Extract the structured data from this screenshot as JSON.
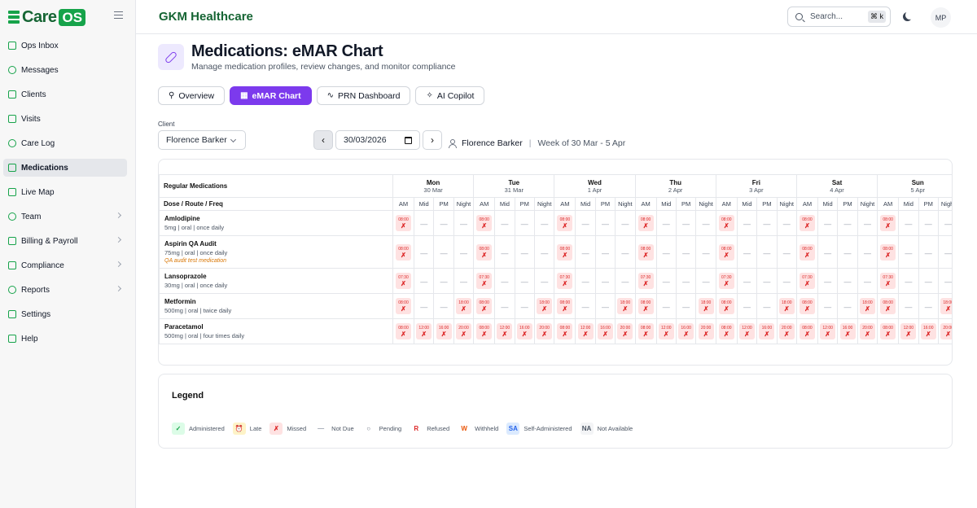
{
  "app": {
    "logo_word": "Care",
    "logo_badge": "OS",
    "org_name": "GKM Healthcare"
  },
  "sidebar": {
    "items": [
      {
        "label": "Ops Inbox",
        "icon": "inbox-icon"
      },
      {
        "label": "Messages",
        "icon": "message-icon"
      },
      {
        "label": "Clients",
        "icon": "users-icon"
      },
      {
        "label": "Visits",
        "icon": "calendar-icon"
      },
      {
        "label": "Care Log",
        "icon": "clipboard-icon"
      },
      {
        "label": "Medications",
        "icon": "pill-icon",
        "active": true
      },
      {
        "label": "Live Map",
        "icon": "radio-icon"
      },
      {
        "label": "Team",
        "icon": "team-icon",
        "chevron": true
      },
      {
        "label": "Billing & Payroll",
        "icon": "billing-icon",
        "chevron": true
      },
      {
        "label": "Compliance",
        "icon": "shield-icon",
        "chevron": true
      },
      {
        "label": "Reports",
        "icon": "bar-chart-icon",
        "chevron": true
      },
      {
        "label": "Settings",
        "icon": "gear-icon"
      },
      {
        "label": "Help",
        "icon": "help-icon"
      }
    ]
  },
  "topbar": {
    "search_placeholder": "Search...",
    "shortcut": "⌘ k",
    "avatar_initials": "MP"
  },
  "page": {
    "title": "Medications: eMAR Chart",
    "subtitle": "Manage medication profiles, review changes, and monitor compliance"
  },
  "tabs": [
    {
      "label": "Overview",
      "icon": "⚲",
      "active": false
    },
    {
      "label": "eMAR Chart",
      "icon": "▦",
      "active": true
    },
    {
      "label": "PRN Dashboard",
      "icon": "∿",
      "active": false
    },
    {
      "label": "AI Copilot",
      "icon": "✧",
      "active": false
    }
  ],
  "filters": {
    "client_label": "Client",
    "client_value": "Florence Barker",
    "date_value": "30/03/2026",
    "prev_label": "‹",
    "next_label": "›",
    "client_name": "Florence Barker",
    "divider": "|",
    "week_label": "Week of 30 Mar - 5 Apr"
  },
  "emar": {
    "header_medications": "Regular Medications",
    "header_dose": "Dose / Route / Freq",
    "days": [
      {
        "name": "Mon",
        "date": "30 Mar"
      },
      {
        "name": "Tue",
        "date": "31 Mar"
      },
      {
        "name": "Wed",
        "date": "1 Apr"
      },
      {
        "name": "Thu",
        "date": "2 Apr"
      },
      {
        "name": "Fri",
        "date": "3 Apr"
      },
      {
        "name": "Sat",
        "date": "4 Apr"
      },
      {
        "name": "Sun",
        "date": "5 Apr"
      }
    ],
    "slots": [
      "AM",
      "Mid",
      "PM",
      "Night"
    ],
    "dash": "—",
    "missed_mark": "✗",
    "medications": [
      {
        "name": "Amlodipine",
        "detail": "5mg | oral | once daily",
        "note": "",
        "slots": [
          "08:00",
          null,
          null,
          null
        ]
      },
      {
        "name": "Aspirin QA Audit",
        "detail": "75mg | oral | once daily",
        "note": "QA audit test medication",
        "slots": [
          "08:00",
          null,
          null,
          null
        ]
      },
      {
        "name": "Lansoprazole",
        "detail": "30mg | oral | once daily",
        "note": "",
        "slots": [
          "07:30",
          null,
          null,
          null
        ]
      },
      {
        "name": "Metformin",
        "detail": "500mg | oral | twice daily",
        "note": "",
        "slots": [
          "08:00",
          null,
          null,
          "18:00"
        ]
      },
      {
        "name": "Paracetamol",
        "detail": "500mg | oral | four times daily",
        "note": "",
        "slots": [
          "08:00",
          "12:00",
          "16:00",
          "20:00"
        ]
      }
    ]
  },
  "legend": {
    "title": "Legend",
    "items": [
      {
        "symbol": "✓",
        "label": "Administered",
        "bg": "#dcfce7",
        "fg": "#16a34a"
      },
      {
        "symbol": "⏰",
        "label": "Late",
        "bg": "#fef3c7",
        "fg": "#d97706"
      },
      {
        "symbol": "✗",
        "label": "Missed",
        "bg": "#fee2e2",
        "fg": "#dc2626"
      },
      {
        "symbol": "—",
        "label": "Not Due",
        "bg": "transparent",
        "fg": "#9ca3af"
      },
      {
        "symbol": "○",
        "label": "Pending",
        "bg": "transparent",
        "fg": "#6b7280"
      },
      {
        "symbol": "R",
        "label": "Refused",
        "bg": "transparent",
        "fg": "#dc2626"
      },
      {
        "symbol": "W",
        "label": "Withheld",
        "bg": "transparent",
        "fg": "#ea580c"
      },
      {
        "symbol": "SA",
        "label": "Self-Administered",
        "bg": "#dbeafe",
        "fg": "#2563eb"
      },
      {
        "symbol": "NA",
        "label": "Not Available",
        "bg": "#f3f4f6",
        "fg": "#4b5563"
      }
    ]
  },
  "colors": {
    "brand": "#16a34a",
    "accent": "#7c3aed",
    "missed": "#dc2626"
  }
}
